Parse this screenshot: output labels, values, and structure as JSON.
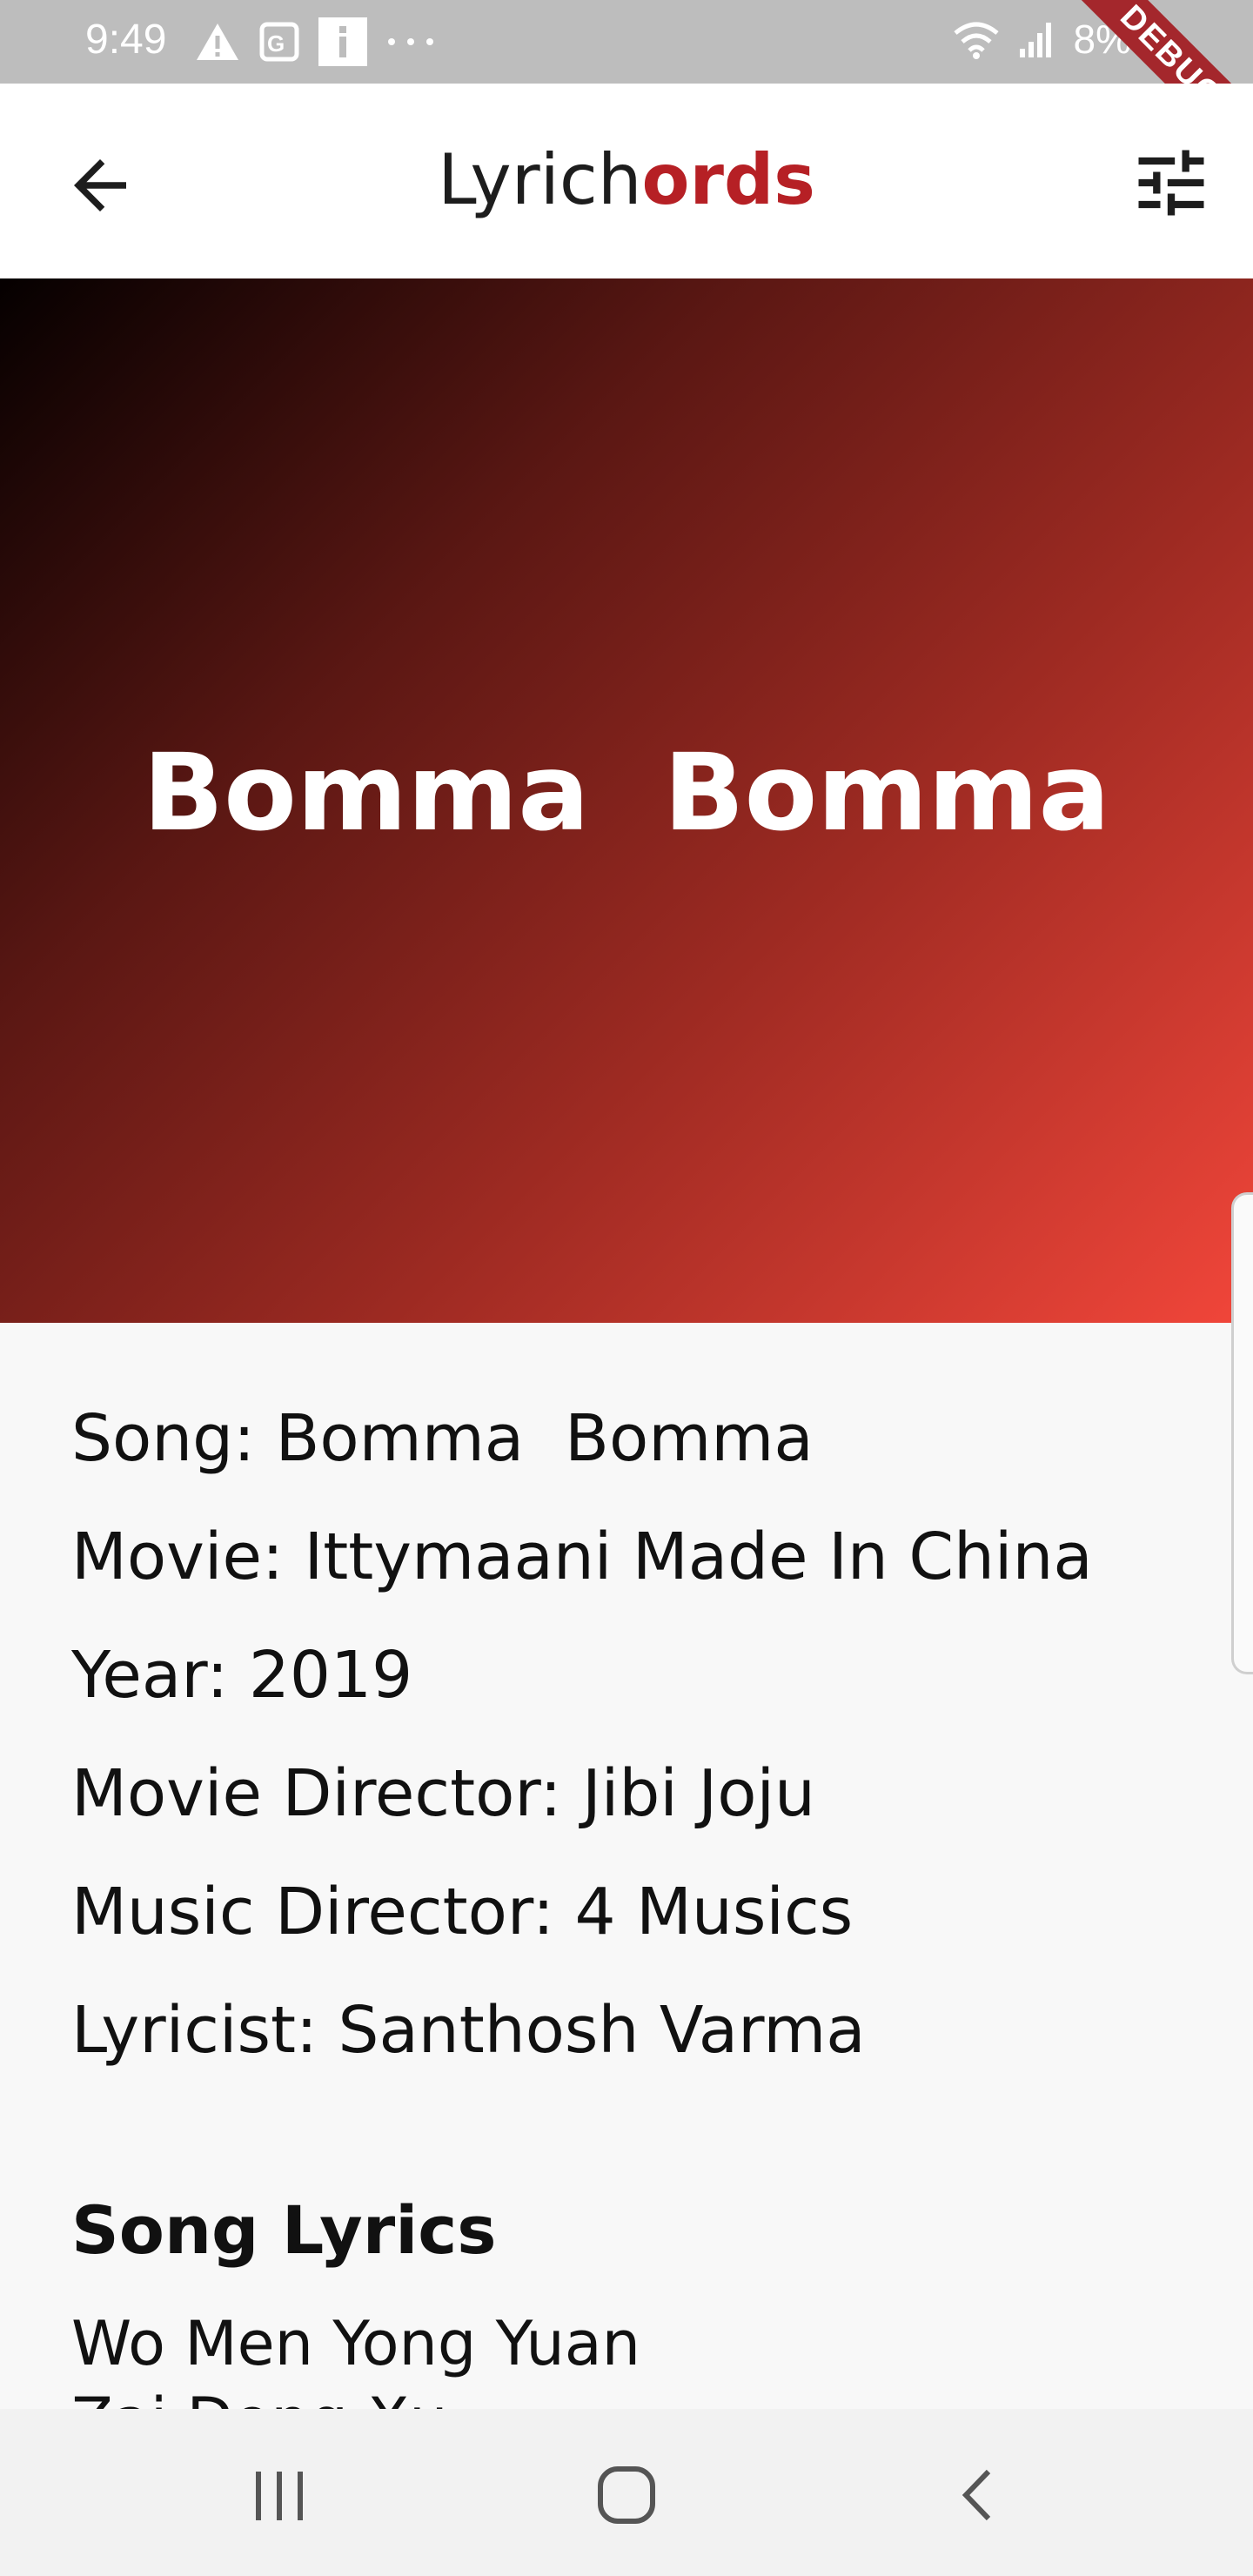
{
  "status_bar": {
    "time": "9:49",
    "battery": "8%"
  },
  "debug_label": "DEBUG",
  "app_bar": {
    "title_part1": "Lyrich",
    "title_part2": "ords"
  },
  "hero": {
    "title": "Bomma  Bomma"
  },
  "details": [
    "Song: Bomma  Bomma",
    "Movie: Ittymaani Made In China",
    "Year: 2019",
    "Movie Director: Jibi Joju",
    "Music Director: 4 Musics",
    "Lyricist: Santhosh Varma"
  ],
  "lyrics": {
    "section_title": "Song Lyrics",
    "line1": "Wo Men Yong Yuan",
    "line2": "Zai Dong Xu"
  },
  "icons": {
    "back": "arrow-back-icon",
    "filter": "tune-icon",
    "nav_recent": "recent-apps-icon",
    "nav_home": "home-icon",
    "nav_back": "nav-back-icon"
  },
  "colors": {
    "brand_dark": "#1d1d1d",
    "brand_red": "#b62025",
    "hero_gradient_start": "#050000",
    "hero_gradient_end": "#f2463a"
  }
}
